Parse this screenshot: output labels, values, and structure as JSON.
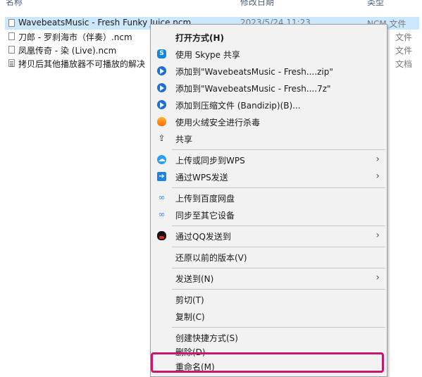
{
  "columns": {
    "name": "名称",
    "date": "修改日期",
    "type": "类型"
  },
  "files": [
    {
      "name": "WavebeatsMusic - Fresh Funky Juice.ncm",
      "date": "2023/5/24 11:23",
      "type": "NCM 文件"
    },
    {
      "name": "刀郎 - 罗刹海市（伴奏）.ncm",
      "date": "",
      "type": "文件"
    },
    {
      "name": "凤凰传奇 - 染 (Live).ncm",
      "date": "",
      "type": "文件"
    },
    {
      "name": "拷贝后其他播放器不可播放的解决",
      "date": "",
      "type": "文档"
    }
  ],
  "menu": {
    "open_with": "打开方式(H)",
    "skype_share": "使用 Skype 共享",
    "add_zip": "添加到\"WavebeatsMusic - Fresh....zip\"",
    "add_7z": "添加到\"WavebeatsMusic - Fresh....7z\"",
    "add_bandizip": "添加到压缩文件 (Bandizip)(B)...",
    "huorong_scan": "使用火绒安全进行杀毒",
    "share": "共享",
    "wps_upload": "上传或同步到WPS",
    "wps_send": "通过WPS发送",
    "baidu_upload": "上传到百度网盘",
    "sync_device": "同步至其它设备",
    "qq_send": "通过QQ发送到",
    "restore_versions": "还原以前的版本(V)",
    "send_to": "发送到(N)",
    "cut": "剪切(T)",
    "copy": "复制(C)",
    "create_shortcut": "创建快捷方式(S)",
    "delete": "删除(D)",
    "rename": "重命名(M)",
    "arrow": "›"
  },
  "icons": {
    "skype": "S",
    "share": "⇪",
    "wps_upload": "☁",
    "wps_send": "➔",
    "baidu": "∞"
  },
  "colors": {
    "highlight": "#c8186b",
    "selection": "#cce8ff"
  }
}
